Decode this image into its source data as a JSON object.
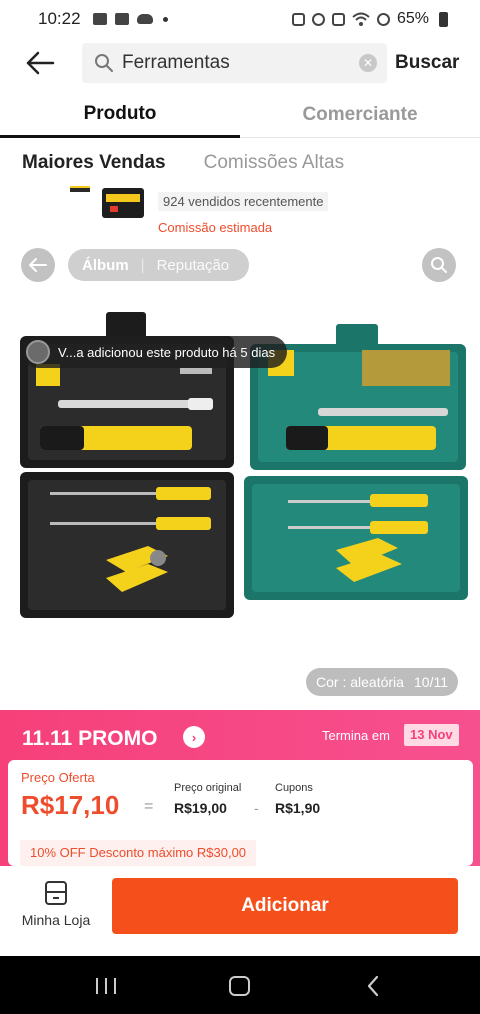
{
  "status_bar": {
    "time": "10:22",
    "battery": "65%"
  },
  "search": {
    "query": "Ferramentas",
    "submit_label": "Buscar"
  },
  "tabs": [
    {
      "label": "Produto",
      "active": true
    },
    {
      "label": "Comerciante",
      "active": false
    }
  ],
  "sort": {
    "options": [
      {
        "label": "Maiores Vendas",
        "active": true
      },
      {
        "label": "Comissões Altas",
        "active": false
      }
    ]
  },
  "previous_item": {
    "sold_text": "924 vendidos recentemente",
    "commission_text": "Comissão estimada"
  },
  "image_viewer": {
    "segment_album": "Álbum",
    "segment_reputation": "Reputação",
    "added_notice": "V...a adicionou este produto há 5 dias",
    "color_label": "Cor : aleatória",
    "image_counter": "10/11"
  },
  "promo": {
    "title": "11.11 PROMO",
    "ends_label": "Termina em",
    "ends_date": "13 Nov",
    "offer_label": "Preço Oferta",
    "offer_price": "R$17,10",
    "equals": "=",
    "original_label": "Preço original",
    "original_price": "R$19,00",
    "minus": "-",
    "coupons_label": "Cupons",
    "coupons_value": "R$1,90",
    "discount_text": "10% OFF Desconto máximo R$30,00"
  },
  "bottom_bar": {
    "store_label": "Minha Loja",
    "add_label": "Adicionar"
  },
  "colors": {
    "accent": "#ee4d2d",
    "promo_pink": "#f6407a",
    "button_orange": "#f5501b"
  }
}
